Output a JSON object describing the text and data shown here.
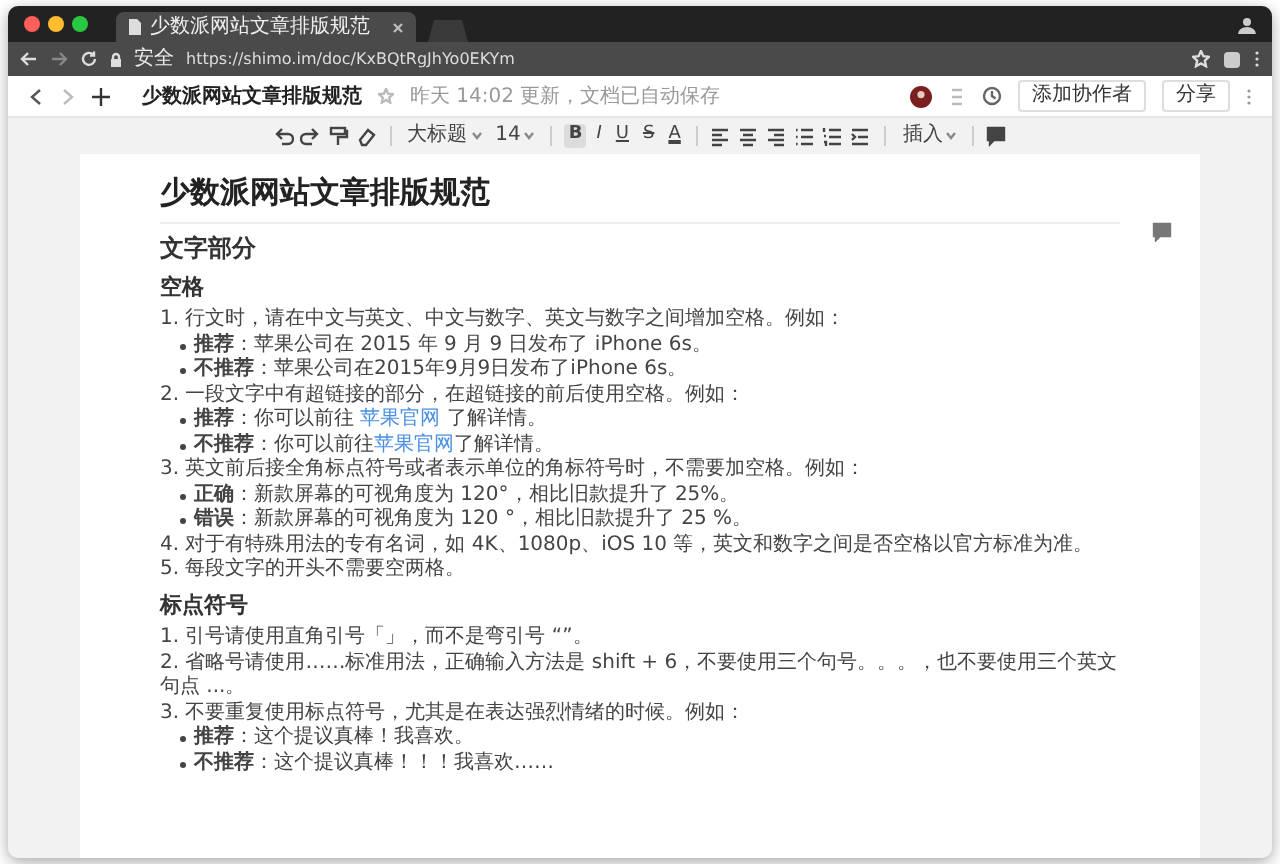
{
  "browser": {
    "tab": {
      "title": "少数派网站文章排版规范"
    },
    "address": {
      "secure_label": "安全",
      "url": "https://shimo.im/doc/KxBQtRgJhYo0EKYm"
    }
  },
  "doc_header": {
    "title": "少数派网站文章排版规范",
    "status": "昨天 14:02 更新，文档已自动保存",
    "buttons": [
      {
        "label": "添加协作者"
      },
      {
        "label": "分享"
      }
    ]
  },
  "toolbar": {
    "groups": [
      [
        {
          "kind": "undo"
        },
        {
          "kind": "redo"
        },
        {
          "kind": "paint"
        },
        {
          "kind": "clear"
        }
      ],
      [
        {
          "kind": "select",
          "label": "大标题"
        },
        {
          "kind": "select",
          "label": "14"
        }
      ],
      [
        {
          "kind": "format",
          "label": "B",
          "selected": true
        },
        {
          "kind": "format",
          "label": "I",
          "selected": false
        },
        {
          "kind": "format",
          "label": "U",
          "selected": false
        },
        {
          "kind": "format",
          "label": "S",
          "selected": false
        },
        {
          "kind": "format",
          "label": "A",
          "selected": false
        }
      ],
      [
        {
          "kind": "align-left"
        },
        {
          "kind": "align-center"
        },
        {
          "kind": "align-right"
        },
        {
          "kind": "bullet-list"
        },
        {
          "kind": "number-list"
        },
        {
          "kind": "indent"
        }
      ],
      [
        {
          "kind": "select",
          "label": "插入"
        }
      ],
      [
        {
          "kind": "comment"
        }
      ]
    ]
  },
  "document": {
    "blocks": [
      {
        "kind": "h1",
        "parts": [
          {
            "kind": "plain",
            "text": "少数派网站文章排版规范"
          }
        ]
      },
      {
        "kind": "h2",
        "parts": [
          {
            "kind": "plain",
            "text": "文字部分"
          }
        ]
      },
      {
        "kind": "h3",
        "parts": [
          {
            "kind": "plain",
            "text": "空格"
          }
        ]
      },
      {
        "kind": "p",
        "parts": [
          {
            "kind": "plain",
            "text": "1. 行文时，请在中文与英文、中文与数字、英文与数字之间增加空格。例如："
          }
        ]
      },
      {
        "kind": "bullet",
        "parts": [
          {
            "kind": "bold",
            "text": "推荐"
          },
          {
            "kind": "plain",
            "text": "：苹果公司在 2015 年 9 月 9 日发布了 iPhone 6s。"
          }
        ]
      },
      {
        "kind": "bullet",
        "parts": [
          {
            "kind": "bold",
            "text": "不推荐"
          },
          {
            "kind": "plain",
            "text": "：苹果公司在2015年9月9日发布了iPhone 6s。"
          }
        ]
      },
      {
        "kind": "p",
        "parts": [
          {
            "kind": "plain",
            "text": "2. 一段文字中有超链接的部分，在超链接的前后使用空格。例如："
          }
        ]
      },
      {
        "kind": "bullet",
        "parts": [
          {
            "kind": "bold",
            "text": "推荐"
          },
          {
            "kind": "plain",
            "text": "：你可以前往 "
          },
          {
            "kind": "link",
            "text": "苹果官网"
          },
          {
            "kind": "plain",
            "text": " 了解详情。"
          }
        ]
      },
      {
        "kind": "bullet",
        "parts": [
          {
            "kind": "bold",
            "text": "不推荐"
          },
          {
            "kind": "plain",
            "text": "：你可以前往"
          },
          {
            "kind": "link",
            "text": "苹果官网"
          },
          {
            "kind": "plain",
            "text": "了解详情。"
          }
        ]
      },
      {
        "kind": "p",
        "parts": [
          {
            "kind": "plain",
            "text": "3. 英文前后接全角标点符号或者表示单位的角标符号时，不需要加空格。例如："
          }
        ]
      },
      {
        "kind": "bullet",
        "parts": [
          {
            "kind": "bold",
            "text": "正确"
          },
          {
            "kind": "plain",
            "text": "：新款屏幕的可视角度为 120°，相比旧款提升了 25%。"
          }
        ]
      },
      {
        "kind": "bullet",
        "parts": [
          {
            "kind": "bold",
            "text": "错误"
          },
          {
            "kind": "plain",
            "text": "：新款屏幕的可视角度为 120 °，相比旧款提升了 25 %。"
          }
        ]
      },
      {
        "kind": "p",
        "parts": [
          {
            "kind": "plain",
            "text": "4. 对于有特殊用法的专有名词，如 4K、1080p、iOS 10 等，英文和数字之间是否空格以官方标准为准。"
          }
        ]
      },
      {
        "kind": "p",
        "parts": [
          {
            "kind": "plain",
            "text": "5. 每段文字的开头不需要空两格。"
          }
        ]
      },
      {
        "kind": "h3",
        "parts": [
          {
            "kind": "plain",
            "text": "标点符号"
          }
        ]
      },
      {
        "kind": "p",
        "parts": [
          {
            "kind": "plain",
            "text": "1. 引号请使用直角引号「」，而不是弯引号 “”。"
          }
        ]
      },
      {
        "kind": "p",
        "parts": [
          {
            "kind": "plain",
            "text": "2. 省略号请使用……标准用法，正确输入方法是 shift + 6，不要使用三个句号。。。，也不要使用三个英文句点 ...。"
          }
        ]
      },
      {
        "kind": "p",
        "parts": [
          {
            "kind": "plain",
            "text": "3. 不要重复使用标点符号，尤其是在表达强烈情绪的时候。例如："
          }
        ]
      },
      {
        "kind": "bullet",
        "parts": [
          {
            "kind": "bold",
            "text": "推荐"
          },
          {
            "kind": "plain",
            "text": "：这个提议真棒！我喜欢。"
          }
        ]
      },
      {
        "kind": "bullet",
        "parts": [
          {
            "kind": "bold",
            "text": "不推荐"
          },
          {
            "kind": "plain",
            "text": "：这个提议真棒！！！我喜欢……"
          }
        ]
      }
    ]
  }
}
